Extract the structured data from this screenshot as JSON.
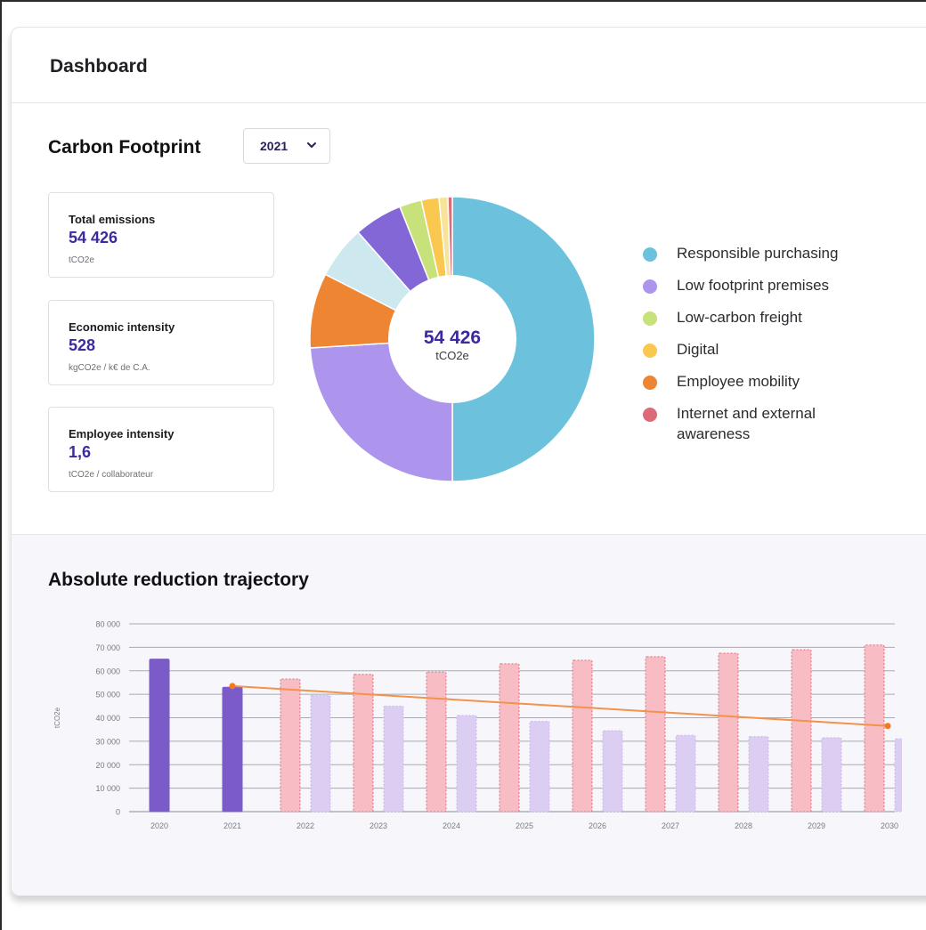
{
  "header": {
    "title": "Dashboard"
  },
  "footprint": {
    "title": "Carbon Footprint",
    "year_selected": "2021",
    "kpis": [
      {
        "label": "Total emissions",
        "value": "54 426",
        "unit": "tCO2e"
      },
      {
        "label": "Economic intensity",
        "value": "528",
        "unit": "kgCO2e / k€ de C.A."
      },
      {
        "label": "Employee intensity",
        "value": "1,6",
        "unit": "tCO2e / collaborateur"
      }
    ],
    "donut_center": {
      "value": "54 426",
      "unit": "tCO2e"
    },
    "legend": [
      {
        "label": "Responsible purchasing",
        "color": "#6cc2dc"
      },
      {
        "label": "Low footprint premises",
        "color": "#ad94ec"
      },
      {
        "label": "Low-carbon freight",
        "color": "#c7e27a"
      },
      {
        "label": "Digital",
        "color": "#fbc84f"
      },
      {
        "label": "Employee mobility",
        "color": "#ee8532"
      },
      {
        "label": "Internet and external awareness",
        "color": "#dd6a78"
      }
    ]
  },
  "trajectory": {
    "title": "Absolute reduction trajectory"
  },
  "colors": {
    "accent": "#3b2aa0",
    "actual_bar": "#7a5bc8",
    "projection_bar": "#f8bdc4",
    "projection_border": "#e0707c",
    "target_bar": "#dccdf3",
    "trend_line": "#f3924a"
  },
  "chart_data": [
    {
      "type": "pie",
      "categories": [
        "Responsible purchasing",
        "Low footprint premises",
        "",
        "Employee mobility",
        "",
        "",
        "Low-carbon freight",
        "Digital",
        "",
        "Internet and external awareness"
      ],
      "values": [
        50,
        24,
        0,
        8.5,
        6,
        5.5,
        2.5,
        2,
        1,
        0.5
      ],
      "colors": [
        "#6cc2dc",
        "#ad94ec",
        "#ad94ec",
        "#ee8532",
        "#cde8ef",
        "#8467d6",
        "#c7e27a",
        "#fbc84f",
        "#f7e49a",
        "#dd6a78"
      ],
      "center_label": "54 426"
    },
    {
      "type": "bar",
      "title": "Absolute reduction trajectory",
      "ylabel": "tCO2e",
      "categories": [
        "2020",
        "2021",
        "2022",
        "2023",
        "2024",
        "2025",
        "2026",
        "2027",
        "2028",
        "2029",
        "2030"
      ],
      "ylim": [
        0,
        80000
      ],
      "yticks": [
        "0",
        "10 000",
        "20 000",
        "30 000",
        "40 000",
        "50 000",
        "60 000",
        "70 000",
        "80 000"
      ],
      "series": [
        {
          "values": [
            65000,
            53000,
            null,
            null,
            null,
            null,
            null,
            null,
            null,
            null,
            null
          ]
        },
        {
          "values": [
            null,
            null,
            56500,
            58500,
            59500,
            63000,
            64500,
            66000,
            67500,
            69000,
            71000
          ]
        },
        {
          "values": [
            null,
            null,
            49500,
            45000,
            41000,
            38500,
            34500,
            32500,
            32000,
            31500,
            31000
          ]
        }
      ],
      "trend": {
        "x": [
          "2021",
          "2030"
        ],
        "y": [
          53500,
          36500
        ]
      },
      "grid": true
    }
  ]
}
